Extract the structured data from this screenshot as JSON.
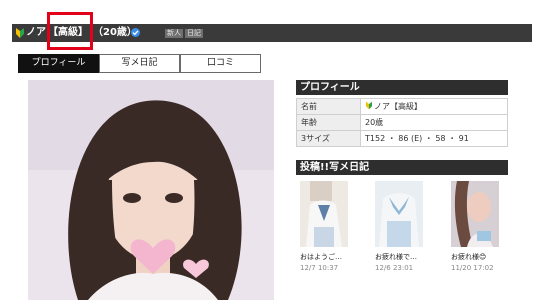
{
  "header": {
    "name": "ノア",
    "rank": "【高級】",
    "age": "（20歳）",
    "badges": [
      "新人",
      "日記"
    ],
    "highlight_color": "#e2001a"
  },
  "tabs": [
    {
      "label": "プロフィール",
      "active": true
    },
    {
      "label": "写メ日記",
      "active": false
    },
    {
      "label": "口コミ",
      "active": false
    }
  ],
  "profile": {
    "title": "プロフィール",
    "rows": [
      {
        "label": "名前",
        "value": "ノア【高級】"
      },
      {
        "label": "年齢",
        "value": "20歳"
      },
      {
        "label": "3サイズ",
        "value": "T152 ・ 86 (E) ・ 58 ・ 91"
      }
    ]
  },
  "diary": {
    "title": "投稿!!写メ日記",
    "posts": [
      {
        "caption": "おはようご…",
        "date": "12/7 10:37"
      },
      {
        "caption": "お疲れ様で…",
        "date": "12/6 23:01"
      },
      {
        "caption": "お疲れ様😊",
        "date": "11/20 17:02"
      }
    ]
  },
  "icons": {
    "beginner": "beginner-leaf-icon",
    "verified": "verified-check-icon"
  },
  "colors": {
    "header_bg": "#3a3a3a",
    "section_bg": "#2e2e2e",
    "verified": "#3b8fe8"
  }
}
